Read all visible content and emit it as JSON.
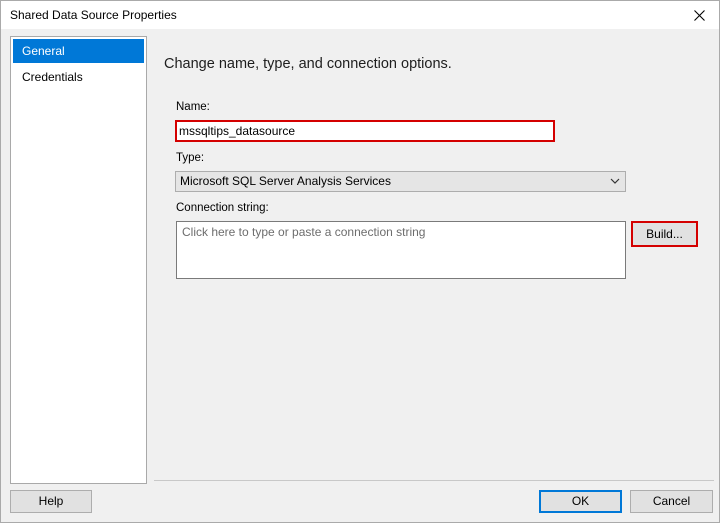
{
  "window": {
    "title": "Shared Data Source Properties"
  },
  "nav": {
    "items": [
      {
        "label": "General",
        "selected": true
      },
      {
        "label": "Credentials",
        "selected": false
      }
    ]
  },
  "general": {
    "heading": "Change name, type, and connection options.",
    "name_label": "Name:",
    "name_value": "mssqltips_datasource",
    "type_label": "Type:",
    "type_value": "Microsoft SQL Server Analysis Services",
    "connection_label": "Connection string:",
    "connection_placeholder": "Click here to type or paste a connection string",
    "build_label": "Build..."
  },
  "footer": {
    "help_label": "Help",
    "ok_label": "OK",
    "cancel_label": "Cancel"
  },
  "colors": {
    "accent": "#0078d7",
    "highlight_border": "#d40000"
  }
}
